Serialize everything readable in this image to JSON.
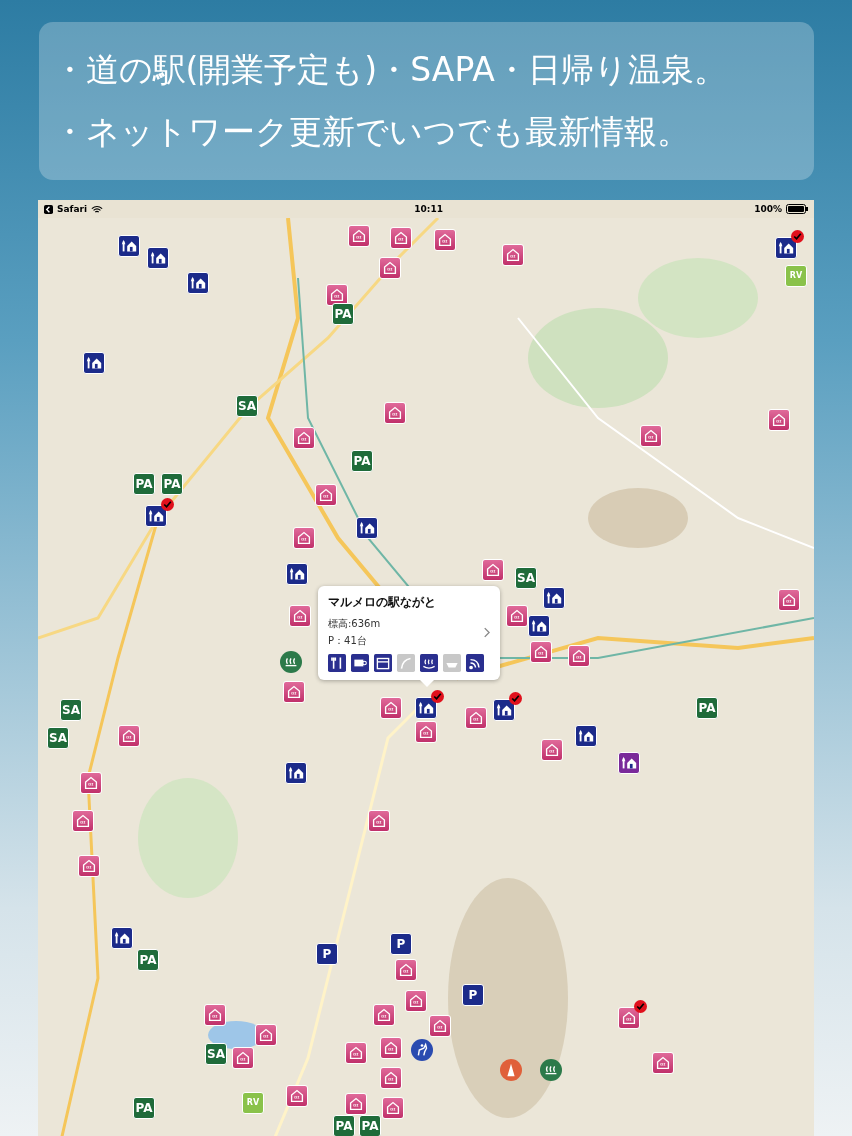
{
  "banner": {
    "lines": [
      "・道の駅(開業予定も)・SAPA・日帰り温泉。",
      "・ネットワーク更新でいつでも最新情報。"
    ]
  },
  "status_bar": {
    "back_app": "Safari",
    "time": "10:11",
    "battery": "100%"
  },
  "callout": {
    "title": "マルメロの駅ながと",
    "elevation": "標高:636m",
    "parking": "P：41台",
    "facilities": [
      {
        "kind": "restaurant",
        "available": true
      },
      {
        "kind": "cafe",
        "available": true
      },
      {
        "kind": "shop",
        "available": true
      },
      {
        "kind": "spa",
        "available": false
      },
      {
        "kind": "onsen",
        "available": true
      },
      {
        "kind": "footbath",
        "available": false
      },
      {
        "kind": "wifi",
        "available": true
      }
    ]
  },
  "pins": [
    {
      "kind": "michi",
      "visited": false
    },
    {
      "kind": "michi",
      "visited": false
    },
    {
      "kind": "michi",
      "visited": false
    },
    {
      "kind": "michi",
      "visited": false
    },
    {
      "kind": "michi",
      "visited": true
    },
    {
      "kind": "michi",
      "visited": false
    },
    {
      "kind": "michi",
      "visited": false
    },
    {
      "kind": "michi",
      "visited": false
    },
    {
      "kind": "michi",
      "visited": false
    },
    {
      "kind": "michi",
      "visited": true
    },
    {
      "kind": "michi",
      "visited": true
    },
    {
      "kind": "michi",
      "visited": false
    },
    {
      "kind": "michi",
      "visited": false
    },
    {
      "kind": "michi",
      "visited": false
    },
    {
      "kind": "michi",
      "visited": true
    },
    {
      "kind": "planned",
      "visited": false
    },
    {
      "kind": "onsen",
      "visited": false
    },
    {
      "kind": "onsen",
      "visited": false
    },
    {
      "kind": "onsen",
      "visited": false
    },
    {
      "kind": "onsen",
      "visited": false
    },
    {
      "kind": "onsen",
      "visited": false
    },
    {
      "kind": "onsen",
      "visited": false
    },
    {
      "kind": "onsen",
      "visited": false
    },
    {
      "kind": "onsen",
      "visited": false
    },
    {
      "kind": "onsen",
      "visited": false
    },
    {
      "kind": "onsen",
      "visited": false
    },
    {
      "kind": "onsen",
      "visited": false
    },
    {
      "kind": "onsen",
      "visited": false
    },
    {
      "kind": "onsen",
      "visited": false
    },
    {
      "kind": "onsen",
      "visited": false
    },
    {
      "kind": "onsen",
      "visited": false
    },
    {
      "kind": "onsen",
      "visited": false
    },
    {
      "kind": "onsen",
      "visited": false
    },
    {
      "kind": "onsen",
      "visited": false
    },
    {
      "kind": "onsen",
      "visited": false
    },
    {
      "kind": "onsen",
      "visited": false
    },
    {
      "kind": "onsen",
      "visited": false
    },
    {
      "kind": "onsen",
      "visited": false
    },
    {
      "kind": "onsen",
      "visited": false
    },
    {
      "kind": "onsen",
      "visited": false
    },
    {
      "kind": "onsen",
      "visited": false
    },
    {
      "kind": "onsen",
      "visited": false
    },
    {
      "kind": "onsen",
      "visited": false
    },
    {
      "kind": "onsen",
      "visited": false
    },
    {
      "kind": "onsen",
      "visited": false
    },
    {
      "kind": "onsen",
      "visited": false
    },
    {
      "kind": "onsen",
      "visited": false
    },
    {
      "kind": "onsen",
      "visited": false
    },
    {
      "kind": "onsen",
      "visited": false
    },
    {
      "kind": "onsen",
      "visited": false
    },
    {
      "kind": "onsen",
      "visited": false
    },
    {
      "kind": "onsen",
      "visited": false
    },
    {
      "kind": "onsen",
      "visited": false
    },
    {
      "kind": "onsen",
      "visited": false
    },
    {
      "kind": "onsen",
      "visited": true
    },
    {
      "kind": "onsen",
      "visited": false
    },
    {
      "kind": "onsen",
      "visited": false
    },
    {
      "kind": "onsen",
      "visited": false
    },
    {
      "kind": "onsen",
      "visited": false
    },
    {
      "kind": "sa",
      "label": "SA",
      "visited": false
    },
    {
      "kind": "sa",
      "label": "SA",
      "visited": false
    },
    {
      "kind": "sa",
      "label": "SA",
      "visited": false
    },
    {
      "kind": "sa",
      "label": "SA",
      "visited": false
    },
    {
      "kind": "sa",
      "label": "SA",
      "visited": false
    },
    {
      "kind": "pa",
      "label": "PA",
      "visited": false
    },
    {
      "kind": "pa",
      "label": "PA",
      "visited": false
    },
    {
      "kind": "pa",
      "label": "PA",
      "visited": false
    },
    {
      "kind": "pa",
      "label": "PA",
      "visited": false
    },
    {
      "kind": "pa",
      "label": "PA",
      "visited": false
    },
    {
      "kind": "pa",
      "label": "PA",
      "visited": false
    },
    {
      "kind": "pa",
      "label": "PA",
      "visited": false
    },
    {
      "kind": "pa",
      "label": "PA",
      "visited": false
    },
    {
      "kind": "pa",
      "label": "PA",
      "visited": false
    },
    {
      "kind": "parking",
      "label": "P",
      "visited": false
    },
    {
      "kind": "parking",
      "label": "P",
      "visited": false
    },
    {
      "kind": "parking",
      "label": "P",
      "visited": false
    },
    {
      "kind": "rv",
      "label": "RV",
      "visited": false
    },
    {
      "kind": "rv",
      "label": "RV",
      "visited": false
    },
    {
      "kind": "spot",
      "visited": false
    },
    {
      "kind": "spot",
      "visited": false
    },
    {
      "kind": "horse",
      "visited": false
    },
    {
      "kind": "tower",
      "visited": false
    }
  ]
}
